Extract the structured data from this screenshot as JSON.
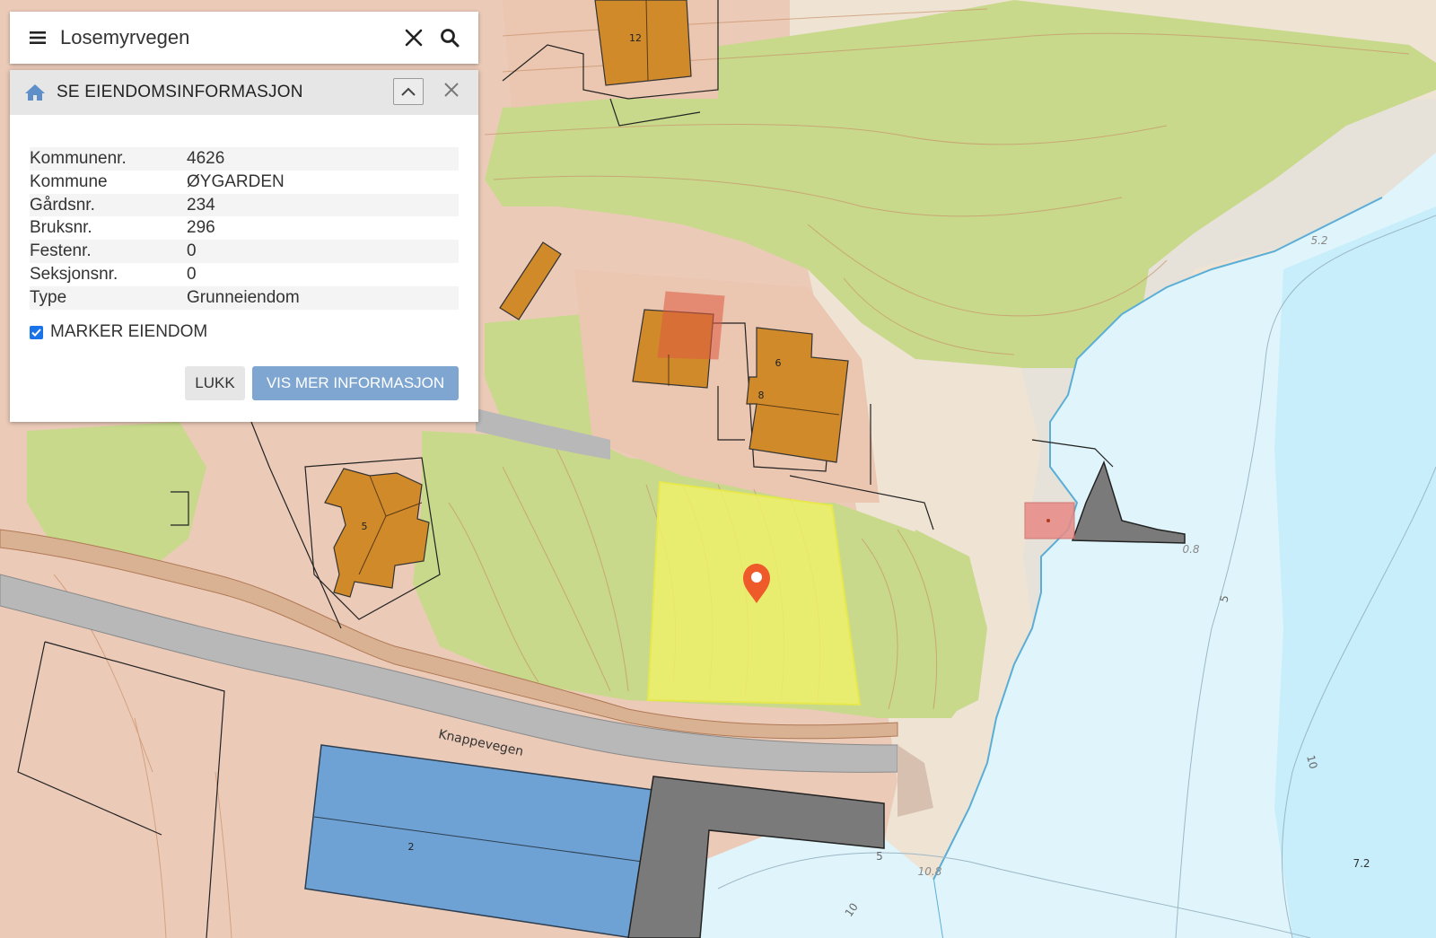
{
  "search": {
    "query": "Losemyrvegen"
  },
  "panel": {
    "title": "SE EIENDOMSINFORMASJON",
    "rows": [
      {
        "label": "Kommunenr.",
        "value": "4626"
      },
      {
        "label": "Kommune",
        "value": "ØYGARDEN"
      },
      {
        "label": "Gårdsnr.",
        "value": "234"
      },
      {
        "label": "Bruksnr.",
        "value": "296"
      },
      {
        "label": "Festenr.",
        "value": "0"
      },
      {
        "label": "Seksjonsnr.",
        "value": "0"
      },
      {
        "label": "Type",
        "value": "Grunneiendom"
      }
    ],
    "mark_label": "MARKER EIENDOM",
    "mark_checked": true,
    "close_label": "LUKK",
    "more_label": "VIS MER INFORMASJON"
  },
  "map": {
    "road_name": "Knappevegen",
    "building_labels": [
      "12",
      "6",
      "8",
      "5",
      "2"
    ],
    "depth_labels": [
      "5.2",
      "0.8",
      "5",
      "10",
      "7.2",
      "10.8",
      "5",
      "10"
    ],
    "colors": {
      "land": "#eccab8",
      "vegetation": "#c8d98b",
      "building": "#d08a2a",
      "industrial_building": "#6fa2d4",
      "water": "#e0f5fb",
      "selected_parcel": "#eef06a",
      "marker": "#ef5a2a"
    }
  }
}
